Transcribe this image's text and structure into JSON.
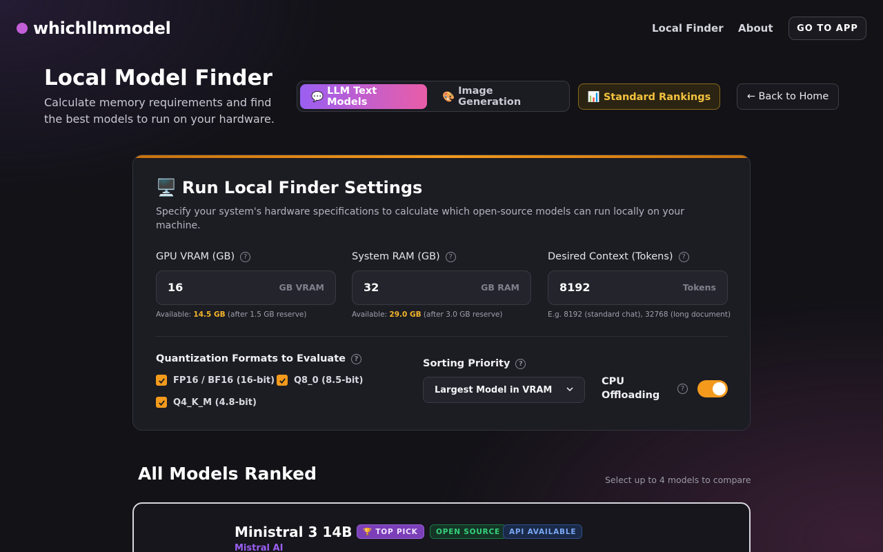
{
  "nav": {
    "logo": "whichllmmodel",
    "links": [
      "Local Finder",
      "About"
    ],
    "cta": "GO TO APP"
  },
  "header": {
    "title": "Local Model Finder",
    "subtitle": "Calculate memory requirements and find the best models to run on your hardware.",
    "modes": [
      {
        "icon": "💬",
        "label": "LLM Text Models",
        "active": true
      },
      {
        "icon": "🎨",
        "label": "Image Generation",
        "active": false
      }
    ],
    "rankings_button": "📊 Standard Rankings",
    "home_button": "← Back to Home"
  },
  "settings": {
    "icon": "🖥️",
    "title": "Run Local Finder Settings",
    "description": "Specify your system's hardware specifications to calculate which open-source models can run locally on your machine.",
    "fields": [
      {
        "label": "GPU VRAM (GB)",
        "value": "16",
        "unit": "GB VRAM",
        "hint_prefix": "Available: ",
        "hint_value": "14.5 GB",
        "hint_suffix": " (after 1.5 GB reserve)"
      },
      {
        "label": "System RAM (GB)",
        "value": "32",
        "unit": "GB RAM",
        "hint_prefix": "Available: ",
        "hint_value": "29.0 GB",
        "hint_suffix": " (after 3.0 GB reserve)"
      },
      {
        "label": "Desired Context (Tokens)",
        "value": "8192",
        "unit": "Tokens",
        "hint_prefix": "E.g. 8192 (standard chat), 32768 (long document)",
        "hint_value": "",
        "hint_suffix": ""
      }
    ],
    "quant_label": "Quantization Formats to Evaluate",
    "quant_options": [
      {
        "label": "FP16 / BF16 (16-bit)",
        "checked": true
      },
      {
        "label": "Q8_0 (8.5-bit)",
        "checked": true
      },
      {
        "label": "Q4_K_M (4.8-bit)",
        "checked": true
      }
    ],
    "sort_label": "Sorting Priority",
    "sort_value": "Largest Model in VRAM",
    "cpu_label": "CPU Offloading",
    "cpu_enabled": true
  },
  "ranking": {
    "title": "All Models Ranked",
    "hint": "Select up to 4 models to compare",
    "models": [
      {
        "name": "Ministral 3 14B",
        "org": "Mistral AI",
        "badges": [
          "🏆 TOP PICK",
          "OPEN SOURCE",
          "API AVAILABLE"
        ]
      }
    ]
  },
  "colors": {
    "accent_orange": "#f39a1c",
    "accent_purple": "#9a5ff2",
    "accent_pink": "#e95da8",
    "gold": "#f4c23e"
  }
}
